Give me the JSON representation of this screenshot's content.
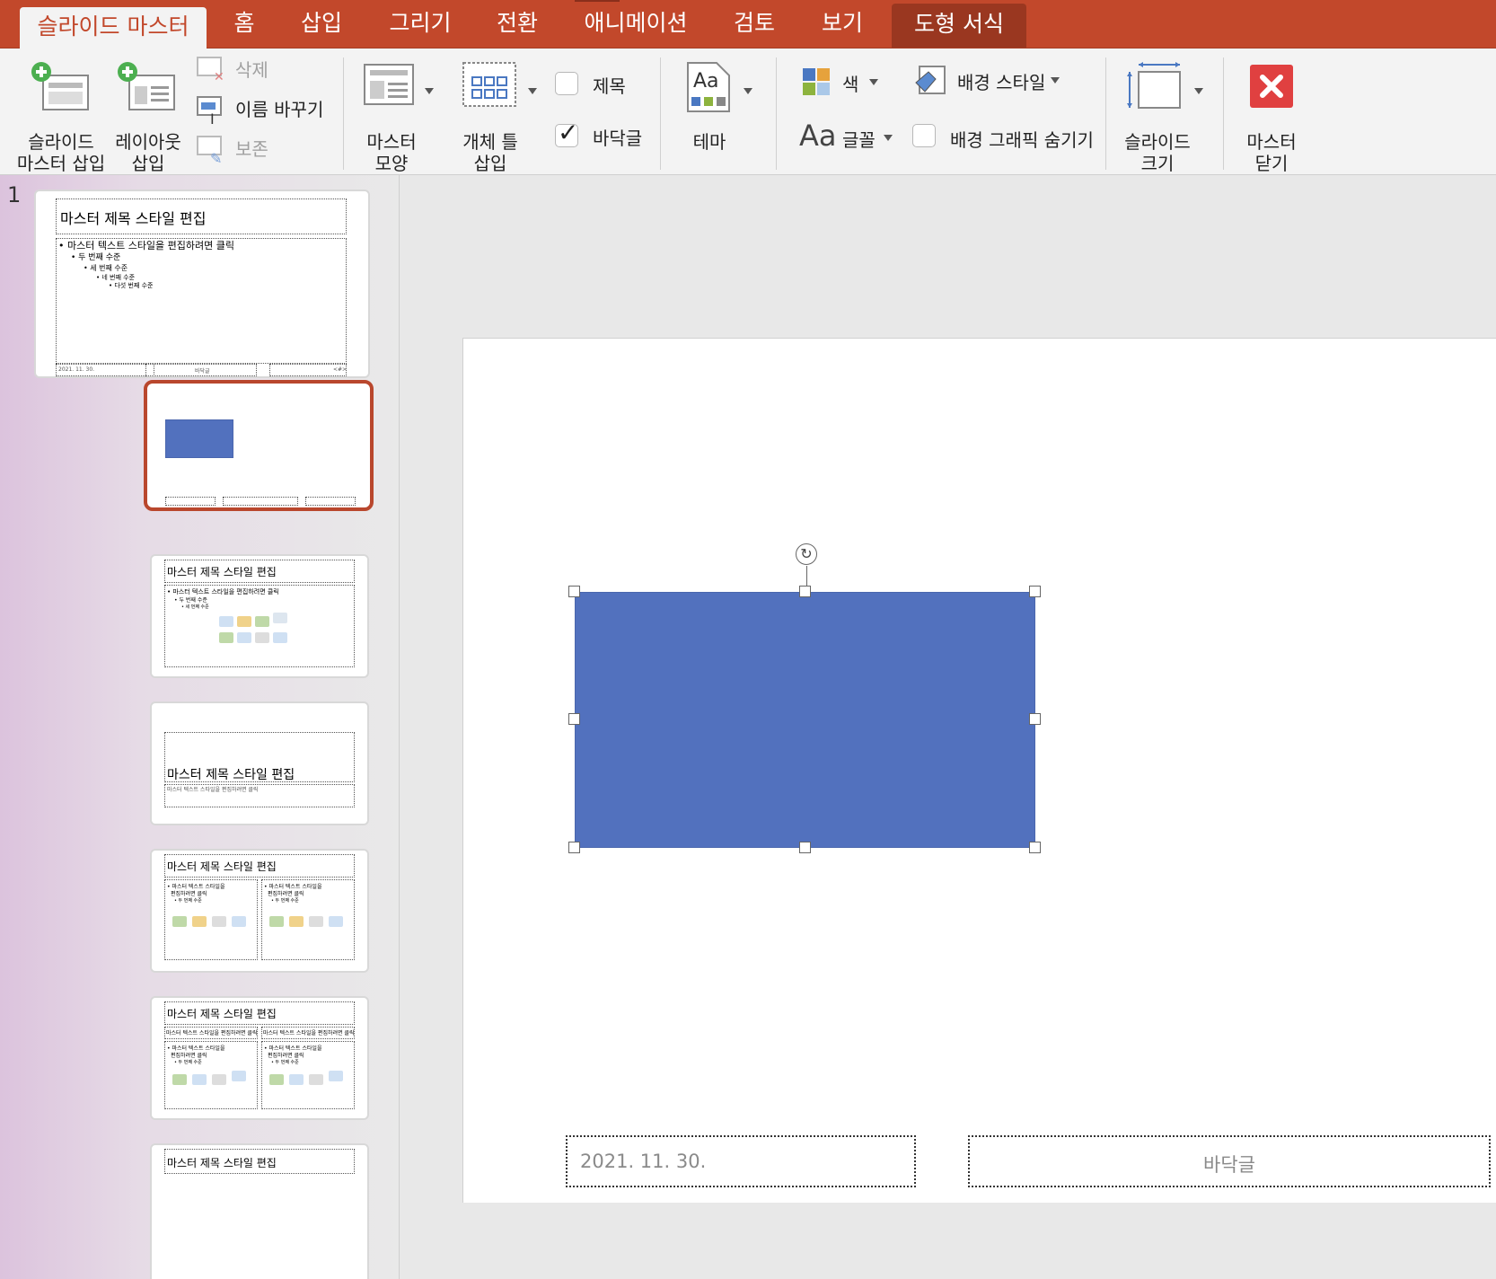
{
  "tabs": {
    "slide_master": "슬라이드 마스터",
    "home": "홈",
    "insert": "삽입",
    "draw": "그리기",
    "transitions": "전환",
    "animations": "애니메이션",
    "review": "검토",
    "view": "보기",
    "shape_format": "도형 서식"
  },
  "ribbon": {
    "insert_slide_master": [
      "슬라이드",
      "마스터 삽입"
    ],
    "insert_layout": [
      "레이아웃",
      "삽입"
    ],
    "delete": "삭제",
    "rename": "이름 바꾸기",
    "preserve": "보존",
    "master_layout": [
      "마스터",
      "모양"
    ],
    "insert_placeholder": [
      "개체 틀",
      "삽입"
    ],
    "title_checkbox": "제목",
    "footer_checkbox": "바닥글",
    "title_checked": false,
    "footer_checked": true,
    "theme": "테마",
    "theme_icon_text": "Aa",
    "colors": "색",
    "fonts": "글꼴",
    "fonts_icon_text": "Aa",
    "background_styles": "배경 스타일",
    "hide_background_graphics": "배경 그래픽 숨기기",
    "hide_background_checked": false,
    "slide_size": [
      "슬라이드",
      "크기"
    ],
    "close_master": [
      "마스터",
      "닫기"
    ]
  },
  "thumbnails": {
    "slide_number": "1",
    "master_title": "마스터 제목 스타일 편집",
    "master_body": [
      "• 마스터 텍스트 스타일을 편집하려면 클릭",
      "• 두 번째 수준",
      "• 세 번째 수준",
      "• 네 번째 수준",
      "• 다섯 번째 수준"
    ],
    "footer_date": "2021. 11. 30.",
    "footer_text": "바닥글",
    "footer_num": "<#>",
    "section_subtitle": "마스터 텍스트 스타일을 편집하려면 클릭",
    "two_col_body": [
      "• 마스터 텍스트 스타일을",
      "편집하려면 클릭",
      "• 두 번째 수준",
      "• 세 번째 수준"
    ],
    "compare_heading": "마스터 텍스트 스타일을 편집하려면 클릭"
  },
  "slide": {
    "footer_date": "2021. 11. 30.",
    "footer_text": "바닥글",
    "shape_color": "#5271be",
    "rotate_icon": "↻"
  },
  "colors": {
    "accent": "#c2482b",
    "context_tab": "#9a3720",
    "selection_border": "#b9472d"
  }
}
